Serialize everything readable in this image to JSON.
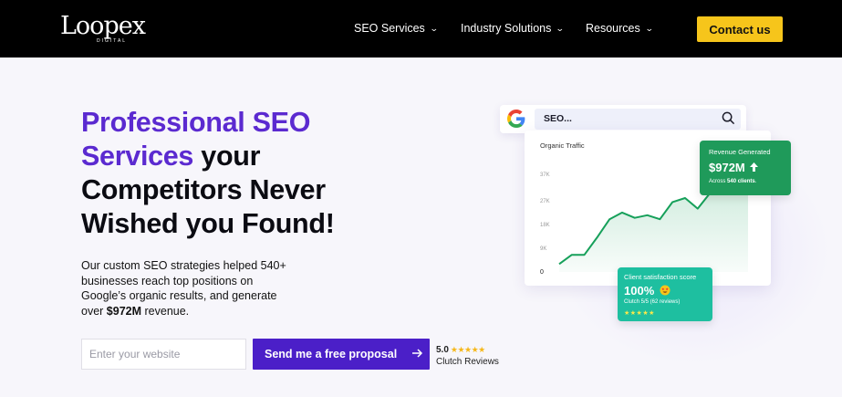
{
  "header": {
    "logo_text": "Loopex",
    "logo_subtext": "DIGITAL",
    "nav": [
      {
        "label": "SEO Services",
        "icon": "chevron-down-icon"
      },
      {
        "label": "Industry Solutions",
        "icon": "chevron-down-icon"
      },
      {
        "label": "Resources",
        "icon": "chevron-down-icon"
      }
    ],
    "contact_label": "Contact us"
  },
  "hero": {
    "headline_purple": "Professional SEO Services",
    "headline_black_inline": "your",
    "headline_line3": "Competitors Never",
    "headline_line4": "Wished you Found!",
    "subtext_before": "Our custom SEO strategies helped 540+ businesses reach top positions on Google’s organic results, and generate over ",
    "subtext_bold": "$972M",
    "subtext_after": " revenue.",
    "input_placeholder": "Enter your website",
    "cta_label": "Send me a free proposal",
    "rating_value": "5.0",
    "rating_stars": "★★★★★",
    "rating_label": "Clutch Reviews"
  },
  "illustration": {
    "search_text": "SEO...",
    "chart_title": "Organic Traffic",
    "revenue": {
      "label": "Revenue Generated",
      "value": "$972M",
      "sub_prefix": "Across ",
      "sub_bold": "540 clients",
      "sub_suffix": "."
    },
    "satisfaction": {
      "label": "Client satisfaction score",
      "value": "100%",
      "sub": "Clutch 5/5 (62 reviews)",
      "stars": "★★★★★"
    },
    "colors": {
      "accent_purple": "#5b2ad0",
      "button_purple": "#4b1fc8",
      "contact_yellow": "#f6c51b",
      "revenue_green": "#1f9a5a",
      "satisfaction_teal": "#1ebfa0",
      "line_green": "#16a05a"
    }
  },
  "chart_data": {
    "type": "area",
    "title": "Organic Traffic",
    "y_ticks": [
      "37K",
      "27K",
      "18K",
      "9K",
      "0"
    ],
    "ylim": [
      0,
      37000
    ],
    "values": [
      3000,
      6500,
      6500,
      13000,
      20000,
      22500,
      20500,
      21500,
      20000,
      26500,
      28000,
      24000,
      30000,
      37000,
      37000,
      35000
    ]
  }
}
